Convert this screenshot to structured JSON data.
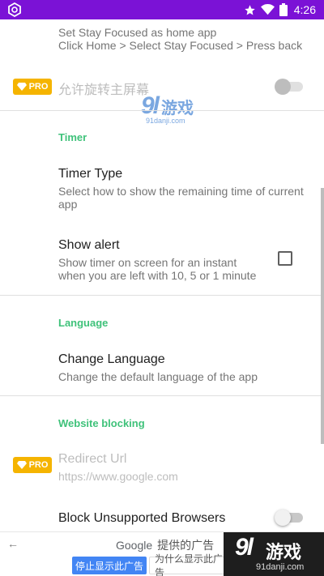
{
  "status_bar": {
    "time": "4:26",
    "icons": [
      "app-logo-icon",
      "star-icon",
      "wifi-icon",
      "battery-icon"
    ]
  },
  "settings": {
    "home_app": {
      "subtitle_1": "Set Stay Focused as home app",
      "subtitle_2": "Click Home > Select Stay Focused > Press back"
    },
    "rotate_home": {
      "badge": "PRO",
      "title": "允许旋转主屏幕"
    },
    "timer_category": "Timer",
    "timer_type": {
      "title": "Timer Type",
      "subtitle_1": "Select how to show the remaining time of current",
      "subtitle_2": "app"
    },
    "show_alert": {
      "title": "Show alert",
      "subtitle_1": "Show timer on screen for an instant",
      "subtitle_2": "when you are left with 10, 5 or 1 minute",
      "checked": false
    },
    "language_category": "Language",
    "change_language": {
      "title": "Change Language",
      "subtitle": "Change the default language of the app"
    },
    "website_category": "Website blocking",
    "redirect_url": {
      "badge": "PRO",
      "title": "Redirect Url",
      "subtitle": "https://www.google.com"
    },
    "block_browsers": {
      "title": "Block Unsupported Browsers",
      "enabled": false
    }
  },
  "watermark": {
    "number": "9l",
    "text": "游戏",
    "site": "91danji.com"
  },
  "ad_bar": {
    "google_label": "Google",
    "provided_text": "提供的广告",
    "stop_button": "停止显示此广告",
    "why_button": "为什么显示此广告",
    "brand_number": "9l",
    "brand_text": "游戏",
    "brand_site": "91danji.com"
  },
  "colors": {
    "status_bar": "#7b12d6",
    "accent": "#3fc27a",
    "pro_badge": "#f5b400",
    "ad_button": "#4285f4"
  }
}
